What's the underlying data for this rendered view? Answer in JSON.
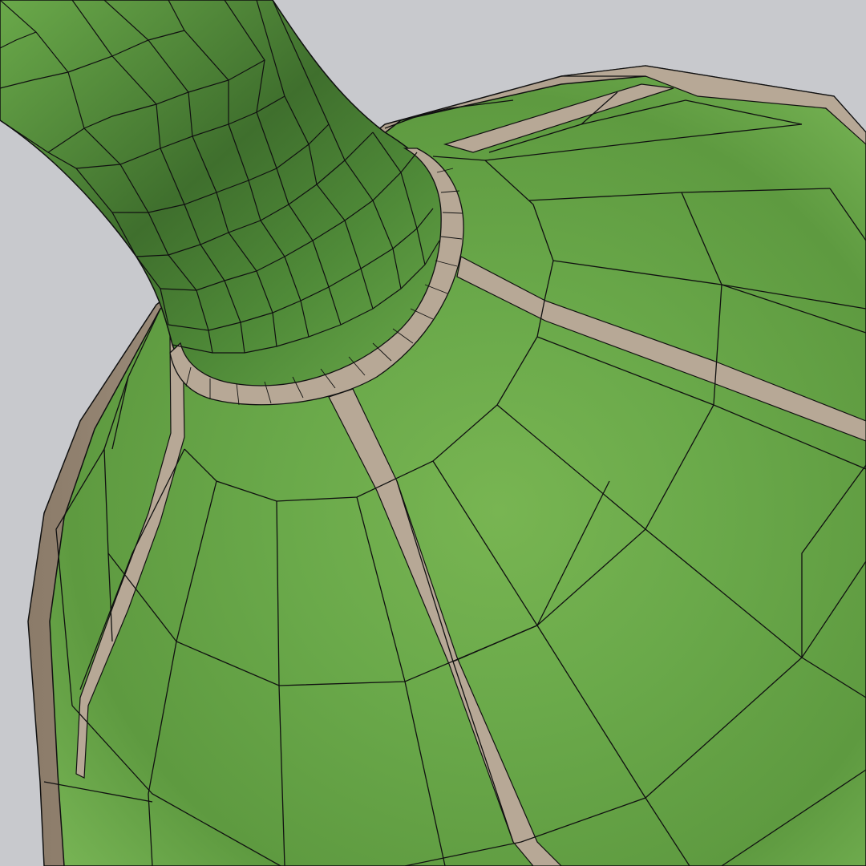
{
  "viewport": {
    "background_color": "#c8c9cd",
    "model": "wireframe-shaded-vase-mesh"
  },
  "colors": {
    "green_light": "#86c262",
    "green_mid": "#6aa94a",
    "green_dark": "#3f6f2d",
    "trim": "#b7a896",
    "trim_dark": "#8b7b69",
    "edge": "#101010"
  }
}
